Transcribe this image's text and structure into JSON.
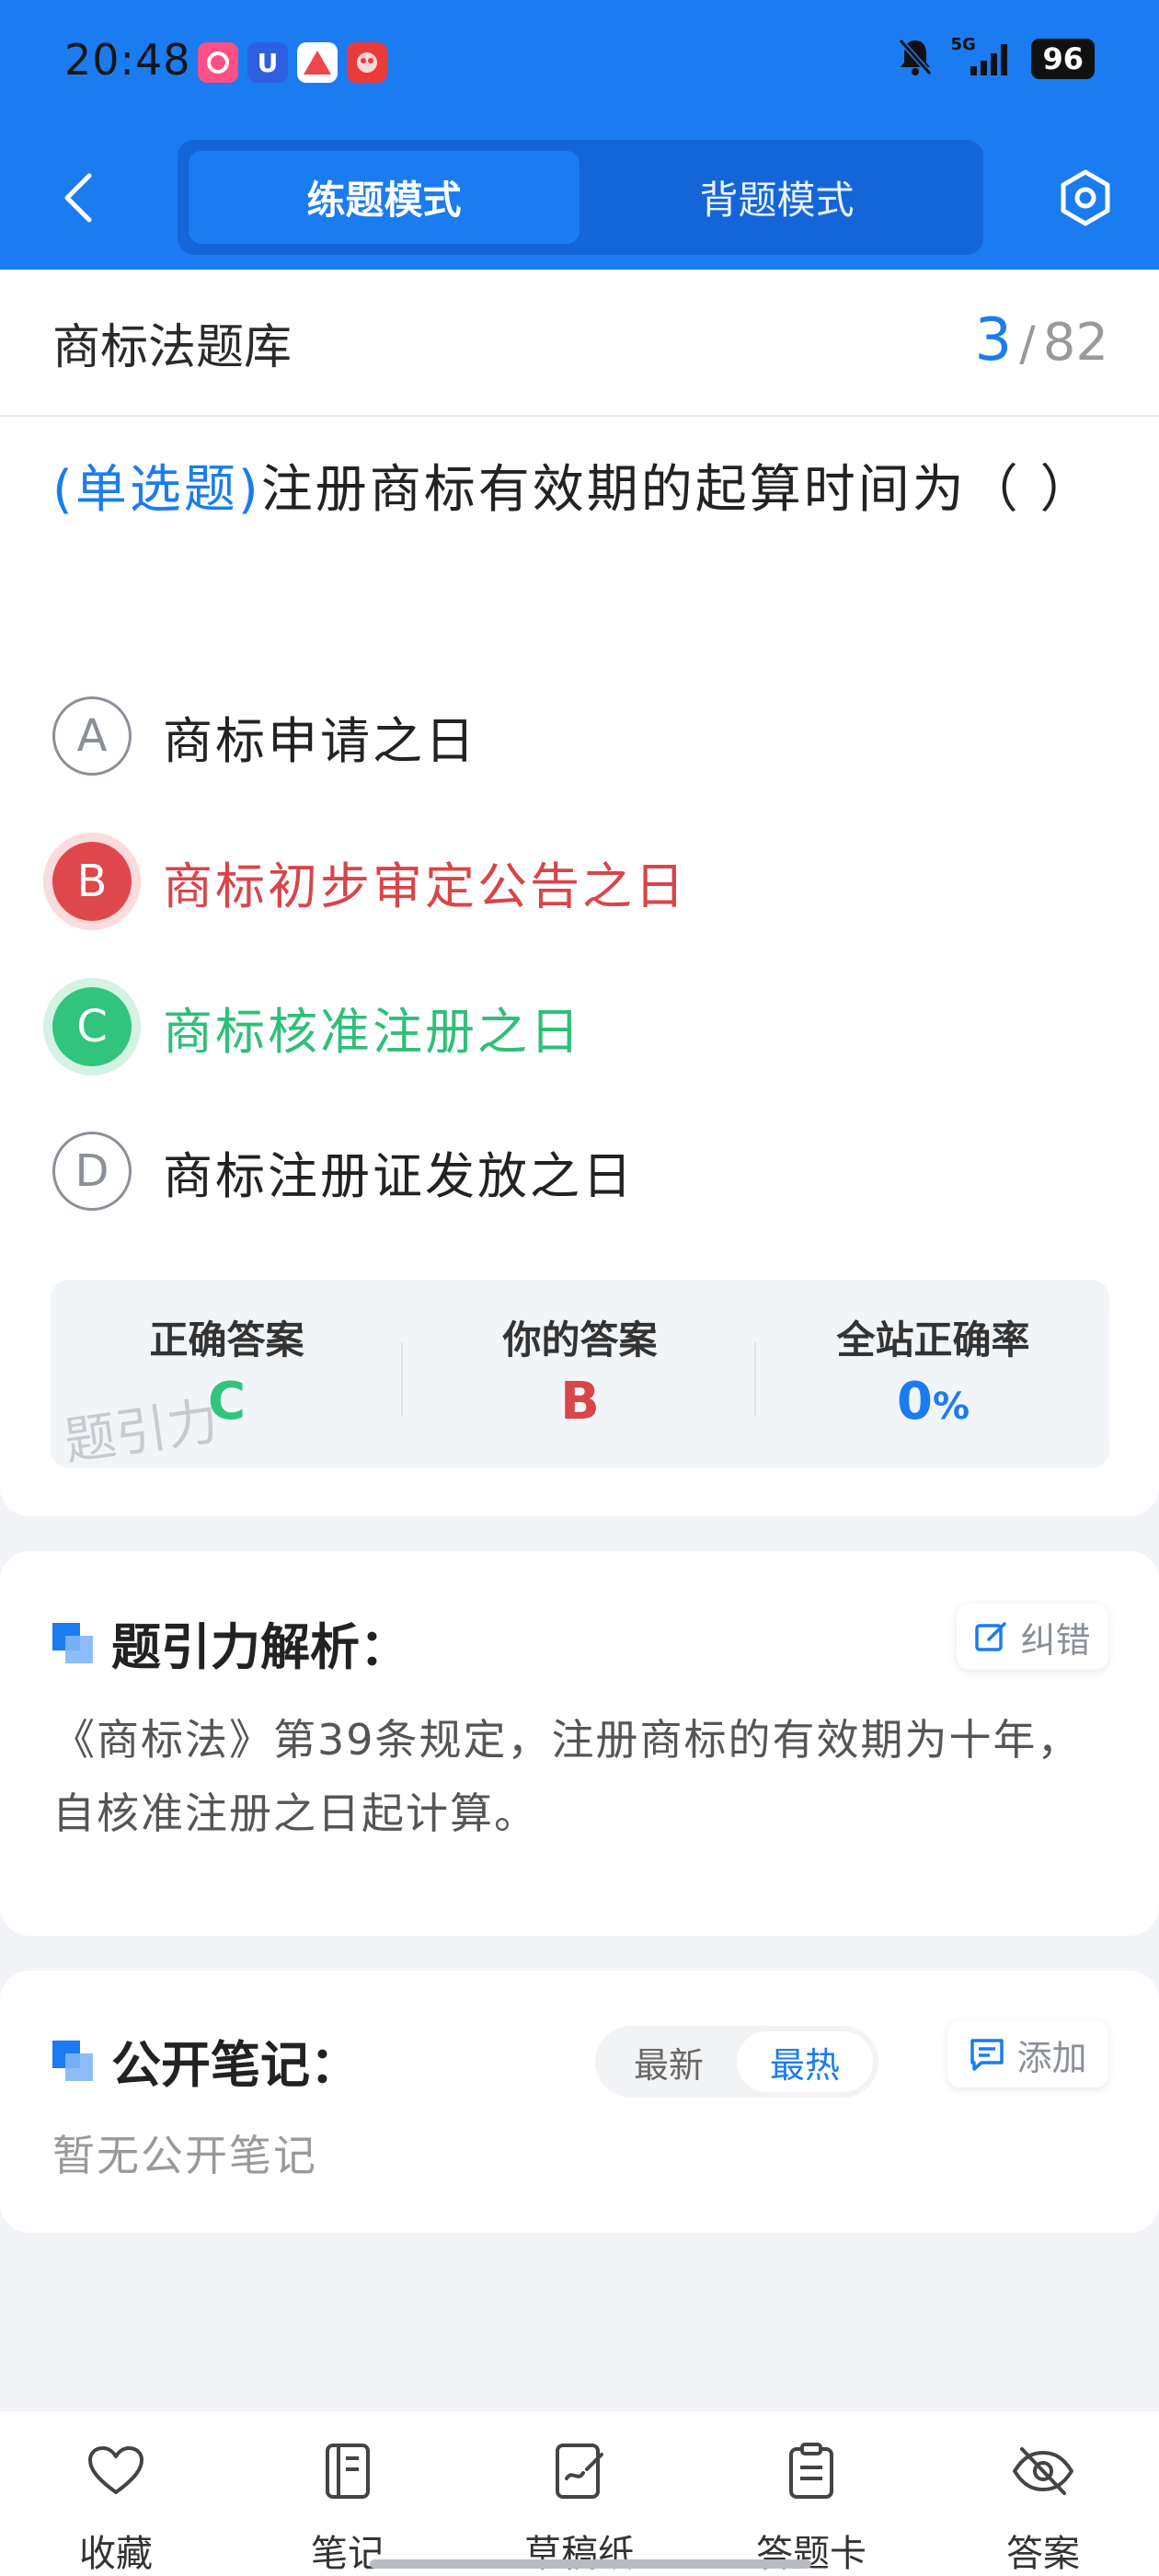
{
  "status_bar": {
    "time": "20:48",
    "network": "5G",
    "battery": "96",
    "app_icons": [
      "app-icon-pink",
      "app-icon-blue-u",
      "app-icon-red-a",
      "app-icon-red-game"
    ]
  },
  "nav": {
    "modes": [
      "练题模式",
      "背题模式"
    ],
    "active_mode": "练题模式"
  },
  "bank": {
    "title": "商标法题库",
    "current": "3",
    "separator": "/",
    "total": "82"
  },
  "question": {
    "type": "(单选题)",
    "text": "注册商标有效期的起算时间为（   ）",
    "options": [
      {
        "letter": "A",
        "text": "商标申请之日",
        "state": "normal"
      },
      {
        "letter": "B",
        "text": "商标初步审定公告之日",
        "state": "wrong"
      },
      {
        "letter": "C",
        "text": "商标核准注册之日",
        "state": "correct"
      },
      {
        "letter": "D",
        "text": "商标注册证发放之日",
        "state": "normal"
      }
    ]
  },
  "answer_summary": {
    "correct_label": "正确答案",
    "correct_value": "C",
    "yours_label": "你的答案",
    "yours_value": "B",
    "rate_label": "全站正确率",
    "rate_value": "0",
    "rate_unit": "%",
    "watermark": "题引力"
  },
  "analysis": {
    "title": "题引力解析：",
    "button": "纠错",
    "text": "《商标法》第39条规定，注册商标的有效期为十年，自核准注册之日起计算。"
  },
  "notes": {
    "title": "公开笔记：",
    "sort_options": [
      "最新",
      "最热"
    ],
    "selected_sort": "最热",
    "add_button": "添加",
    "empty_text": "暂无公开笔记"
  },
  "bottom_tabs": [
    {
      "label": "收藏",
      "icon": "heart-icon"
    },
    {
      "label": "笔记",
      "icon": "notebook-icon"
    },
    {
      "label": "草稿纸",
      "icon": "draft-paper-icon"
    },
    {
      "label": "答题卡",
      "icon": "clipboard-icon"
    },
    {
      "label": "答案",
      "icon": "eye-off-icon"
    }
  ],
  "colors": {
    "brand_blue": "#1a7cf0",
    "correct_green": "#31c47c",
    "wrong_red": "#e0474c"
  }
}
